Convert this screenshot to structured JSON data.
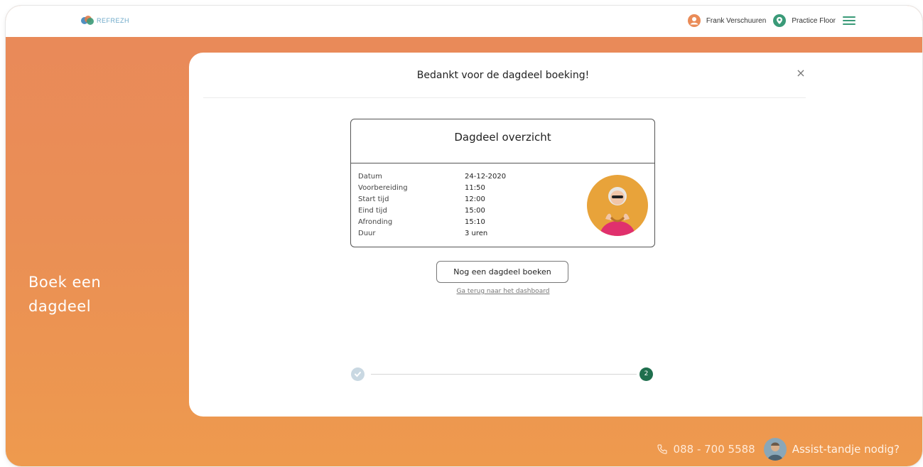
{
  "header": {
    "logo_text": "REFREZH",
    "user_name": "Frank Verschuuren",
    "location": "Practice Floor"
  },
  "sidebar": {
    "title_line1": "Boek een",
    "title_line2": "dagdeel"
  },
  "modal": {
    "title": "Bedankt voor de dagdeel boeking!",
    "close_label": "×",
    "card_title": "Dagdeel overzicht",
    "rows": [
      {
        "label": "Datum",
        "value": "24-12-2020"
      },
      {
        "label": "Voorbereiding",
        "value": "11:50"
      },
      {
        "label": "Start tijd",
        "value": "12:00"
      },
      {
        "label": "Eind tijd",
        "value": "15:00"
      },
      {
        "label": "Afronding",
        "value": "15:10"
      },
      {
        "label": "Duur",
        "value": "3 uren"
      }
    ],
    "book_again_label": "Nog een dagdeel boeken",
    "back_link": "Ga terug naar het dashboard",
    "steps": {
      "step2_label": "2"
    }
  },
  "footer": {
    "phone": "088 - 700 5588",
    "assist_label": "Assist-tandje nodig?"
  },
  "colors": {
    "brand_orange": "#ea8b57",
    "brand_green": "#1f6f4e",
    "accent_teal": "#3a9a78"
  }
}
